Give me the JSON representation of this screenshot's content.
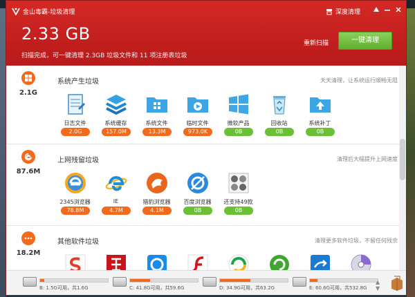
{
  "app": {
    "title": "金山毒霸-垃圾清理"
  },
  "header": {
    "deep_clean_label": "深度清理",
    "total_size": "2.33 GB",
    "summary": "扫描完成，可一键清理 2.3GB 垃圾文件和 11 项注册表垃圾",
    "rescan_label": "重新扫描",
    "one_click_label": "一键清理"
  },
  "colors": {
    "brand_red": "#c21f1e",
    "accent_orange": "#f26a1b",
    "ok_green": "#6cc036"
  },
  "sections": [
    {
      "title": "系统产生垃圾",
      "size": "2.1G",
      "hint": "天天清理，让系统运行顺畅无阻",
      "icon": "windows-icon",
      "items": [
        {
          "name": "日志文件",
          "value": "2.0G",
          "status": "orange",
          "icon": "log-file-icon"
        },
        {
          "name": "系统缓存",
          "value": "157.0M",
          "status": "orange",
          "icon": "cache-stack-icon"
        },
        {
          "name": "系统文件",
          "value": "13.3M",
          "status": "orange",
          "icon": "system-folder-icon"
        },
        {
          "name": "临时文件",
          "value": "973.0K",
          "status": "orange",
          "icon": "temp-folder-icon"
        },
        {
          "name": "微软产品",
          "value": "0B",
          "status": "green",
          "icon": "microsoft-icon"
        },
        {
          "name": "回收站",
          "value": "0B",
          "status": "green",
          "icon": "recycle-bin-icon"
        },
        {
          "name": "系统补丁",
          "value": "0B",
          "status": "green",
          "icon": "patch-folder-icon"
        }
      ]
    },
    {
      "title": "上网残留垃圾",
      "size": "87.6M",
      "hint": "清理后大幅提升上网速度",
      "icon": "browser-icon",
      "items": [
        {
          "name": "2345浏览器",
          "value": "78.8M",
          "status": "orange",
          "icon": "browser-2345-icon"
        },
        {
          "name": "IE",
          "value": "4.7M",
          "status": "orange",
          "icon": "ie-icon"
        },
        {
          "name": "猎豹浏览器",
          "value": "4.1M",
          "status": "orange",
          "icon": "liebao-browser-icon"
        },
        {
          "name": "百度浏览器",
          "value": "0B",
          "status": "green",
          "icon": "baidu-browser-icon"
        },
        {
          "name": "还支持49款",
          "value": "0B",
          "status": "green",
          "icon": "more-browsers-icon"
        }
      ]
    },
    {
      "title": "其他软件垃圾",
      "size": "18.2M",
      "hint": "清理更多软件垃圾，不留任何残余",
      "icon": "more-icon"
    }
  ],
  "drives": [
    {
      "label": "B: 1.5G可用，共1.6G",
      "used_fraction": 0.06
    },
    {
      "label": "C: 41.8G可用，共59.6G",
      "used_fraction": 0.3
    },
    {
      "label": "D: 34.9G可用，共63.2G",
      "used_fraction": 0.45
    },
    {
      "label": "E: 60.6G可用，共532.8G",
      "used_fraction": 0.11
    }
  ]
}
